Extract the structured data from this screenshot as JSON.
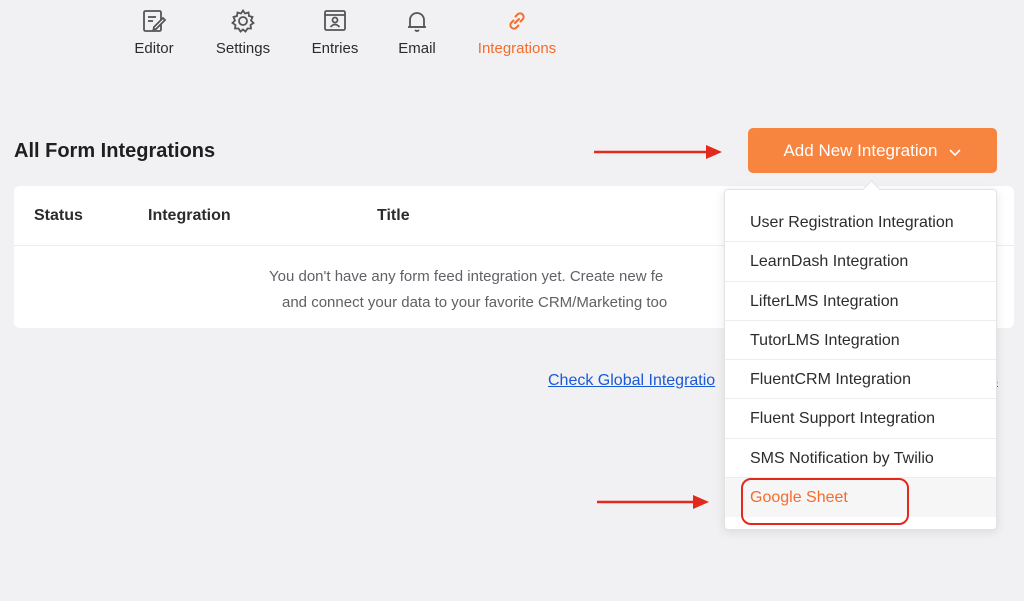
{
  "nav": {
    "tabs": [
      {
        "label": "Editor",
        "icon": "edit-icon"
      },
      {
        "label": "Settings",
        "icon": "gear-icon"
      },
      {
        "label": "Entries",
        "icon": "entries-icon"
      },
      {
        "label": "Email",
        "icon": "bell-icon"
      },
      {
        "label": "Integrations",
        "icon": "link-icon",
        "active": true
      }
    ]
  },
  "section": {
    "title": "All Form Integrations",
    "add_button_label": "Add New Integration"
  },
  "table": {
    "columns": [
      "Status",
      "Integration",
      "Title"
    ],
    "empty_line1": "You don't have any form feed integration yet. Create new fe",
    "empty_line2": "and connect your data to your favorite CRM/Marketing too"
  },
  "global_link": {
    "label": "Check Global Integratio",
    "tail": "s"
  },
  "dropdown": {
    "items": [
      "User Registration Integration",
      "LearnDash Integration",
      "LifterLMS Integration",
      "TutorLMS Integration",
      "FluentCRM Integration",
      "Fluent Support Integration",
      "SMS Notification by Twilio",
      "Google Sheet"
    ],
    "highlighted": "Google Sheet"
  },
  "colors": {
    "accent": "#f7843f",
    "active_text": "#f56c2c",
    "annotation": "#e4281c",
    "link": "#1a59d6"
  }
}
